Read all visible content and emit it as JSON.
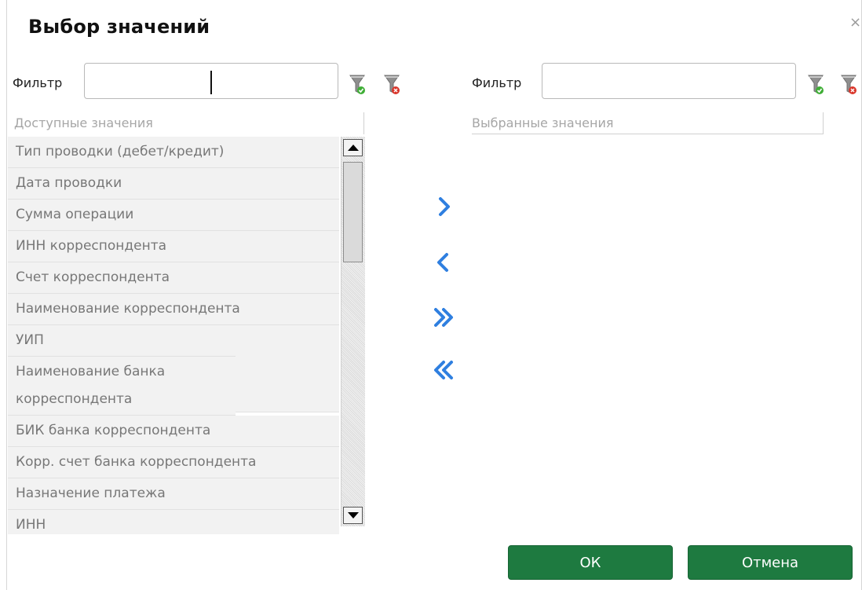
{
  "dialog": {
    "title": "Выбор значений",
    "close": "×"
  },
  "left": {
    "filter_label": "Фильтр",
    "filter_value": "",
    "header": "Доступные значения",
    "items": [
      "Тип проводки (дебет/кредит)",
      "Дата проводки",
      "Сумма операции",
      "ИНН корреспондента",
      "Счет корреспондента",
      "Наименование корреспондента",
      "УИП",
      "Наименование банка корреспондента",
      "БИК банка корреспондента",
      "Корр. счет банка корреспондента",
      "Назначение платежа",
      "ИНН"
    ]
  },
  "right": {
    "filter_label": "Фильтр",
    "filter_value": "",
    "header": "Выбранные значения",
    "items": []
  },
  "footer": {
    "ok": "ОК",
    "cancel": "Отмена"
  },
  "colors": {
    "accent_blue": "#2f7fe0",
    "button_green": "#1e7a40",
    "apply_green": "#3fae36",
    "clear_red": "#d9362b"
  },
  "icons": [
    "apply-filter-icon",
    "clear-filter-icon",
    "move-right-icon",
    "move-left-icon",
    "move-all-right-icon",
    "move-all-left-icon"
  ]
}
